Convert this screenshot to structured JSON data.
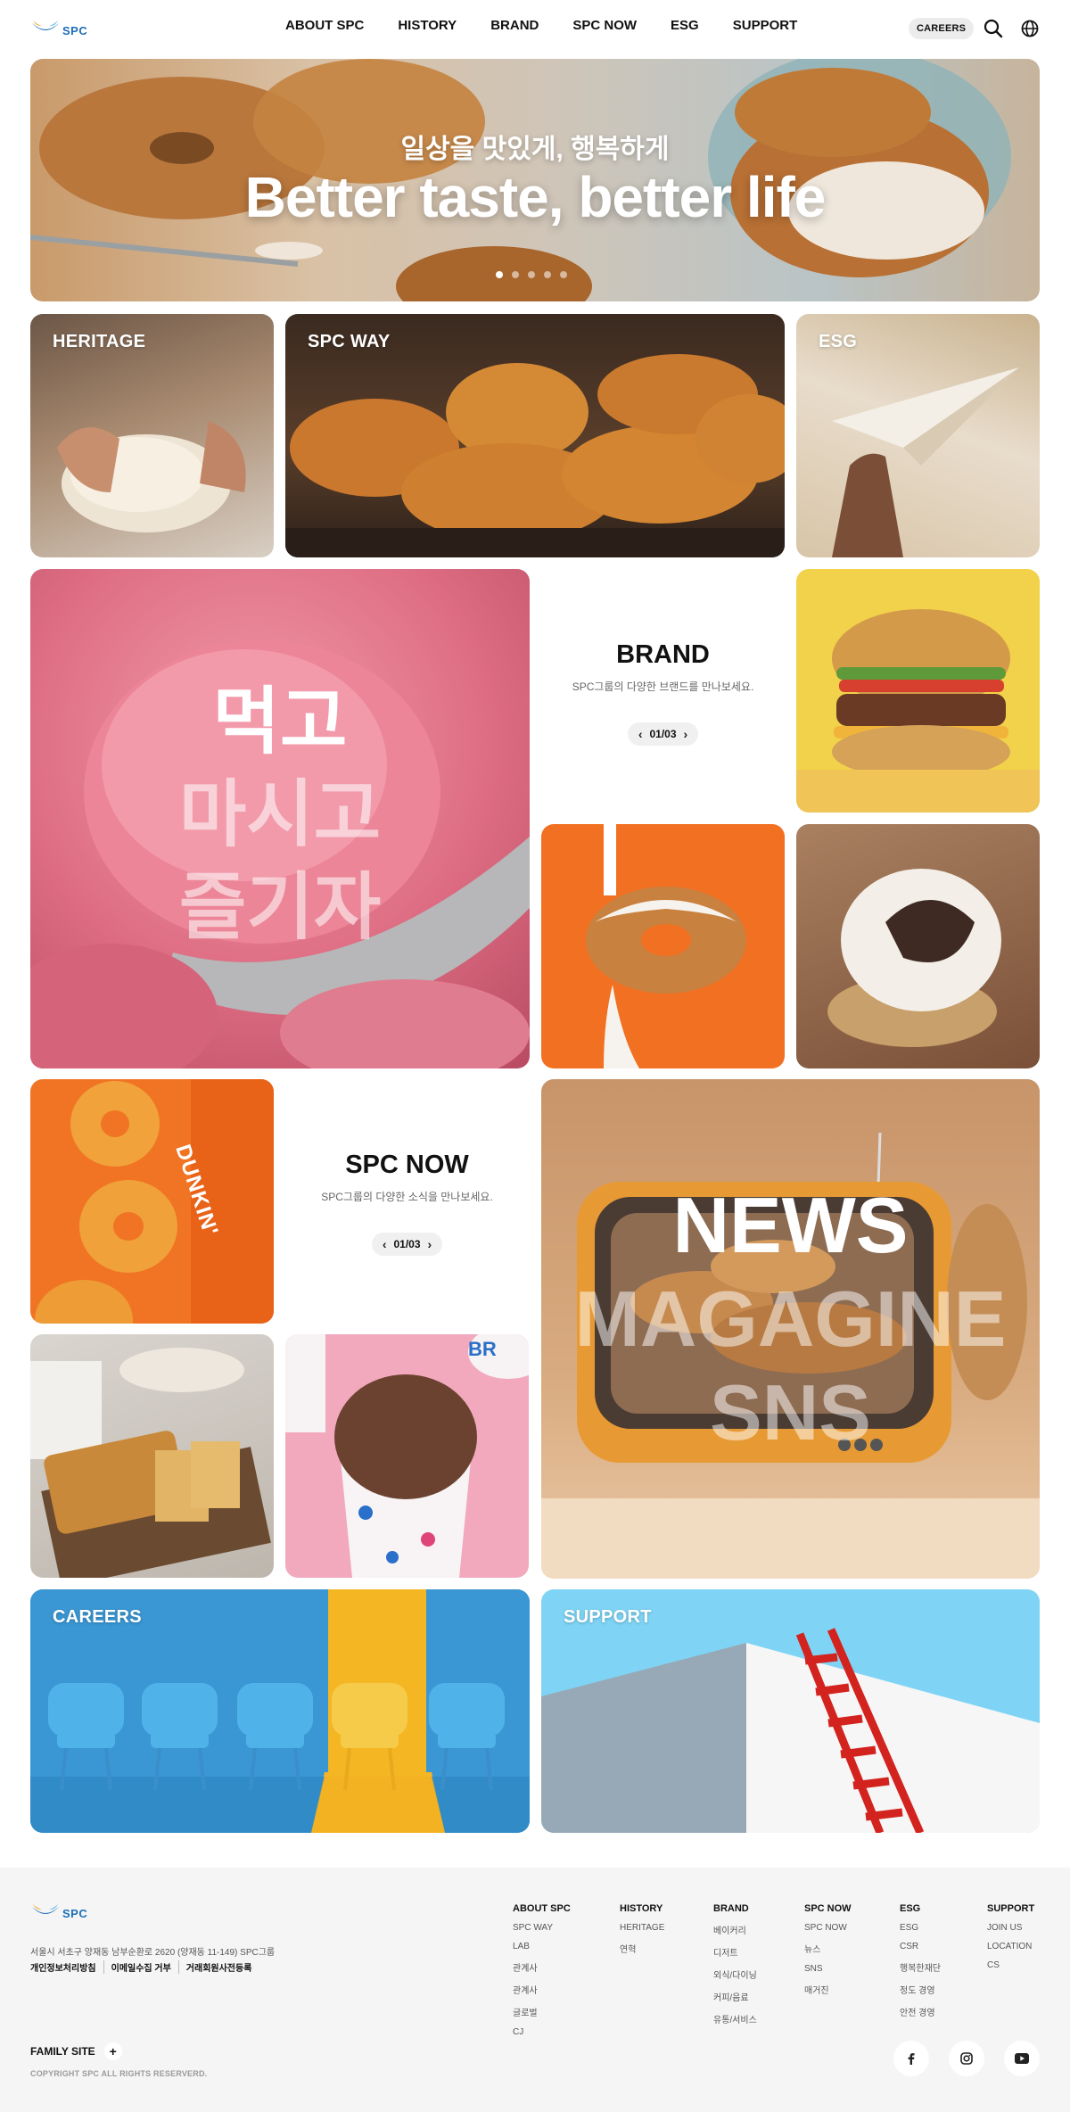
{
  "header": {
    "logo_text": "SPC",
    "nav": [
      "ABOUT SPC",
      "HISTORY",
      "BRAND",
      "SPC NOW",
      "ESG",
      "SUPPORT"
    ],
    "careers_label": "CAREERS",
    "icons": [
      "search-icon",
      "globe-icon"
    ]
  },
  "hero": {
    "subtitle": "일상을 맛있게, 행복하게",
    "title": "Better taste, better life",
    "slide_count": 5,
    "active_slide": 1
  },
  "tiles": {
    "heritage": "HERITAGE",
    "spc_way": "SPC WAY",
    "esg": "ESG",
    "careers": "CAREERS",
    "support": "SUPPORT"
  },
  "brand_section": {
    "title": "BRAND",
    "subtitle": "SPC그룹의 다양한 브랜드를 만나보세요.",
    "pager": "01/03"
  },
  "icecream_overlay": [
    "먹고",
    "마시고",
    "즐기자"
  ],
  "dunkin_text": "DUNKIN'",
  "br_text": "BR",
  "spcnow_section": {
    "title": "SPC NOW",
    "subtitle": "SPC그룹의 다양한 소식을 만나보세요.",
    "pager": "01/03"
  },
  "news_overlay": [
    "NEWS",
    "MAGAGINE",
    "SNS"
  ],
  "footer": {
    "logo_text": "SPC",
    "address": "서울시 서초구 양재동 남부순환로 2620 (양재동 11-149) SPC그룹",
    "links": [
      "개인정보처리방침",
      "이메일수집 거부",
      "거래회원사전등록"
    ],
    "family_site": "FAMILY SITE",
    "copyright": "COPYRIGHT SPC ALL RIGHTS RESERVERD.",
    "columns": [
      {
        "title": "ABOUT SPC",
        "items": [
          "SPC WAY",
          "LAB",
          "관계사",
          "관계사",
          "글로벌",
          "CJ"
        ]
      },
      {
        "title": "HISTORY",
        "items": [
          "HERITAGE",
          "연혁"
        ]
      },
      {
        "title": "BRAND",
        "items": [
          "베이커리",
          "디저트",
          "외식/다이닝",
          "커피/음료",
          "유통/서비스"
        ]
      },
      {
        "title": "SPC NOW",
        "items": [
          "SPC NOW",
          "뉴스",
          "SNS",
          "매거진"
        ]
      },
      {
        "title": "ESG",
        "items": [
          "ESG",
          "CSR",
          "행복한재단",
          "정도 경영",
          "안전 경영"
        ]
      },
      {
        "title": "SUPPORT",
        "items": [
          "JOIN US",
          "LOCATION",
          "CS"
        ]
      }
    ],
    "social": [
      "facebook-icon",
      "instagram-icon",
      "youtube-icon"
    ]
  },
  "colors": {
    "brand_blue": "#1d6fb8",
    "orange": "#f26b1d",
    "pink": "#e78a9a",
    "careers_blue": "#3d9ad6",
    "careers_yellow": "#f5b623",
    "support_sky": "#7fd4f5"
  }
}
